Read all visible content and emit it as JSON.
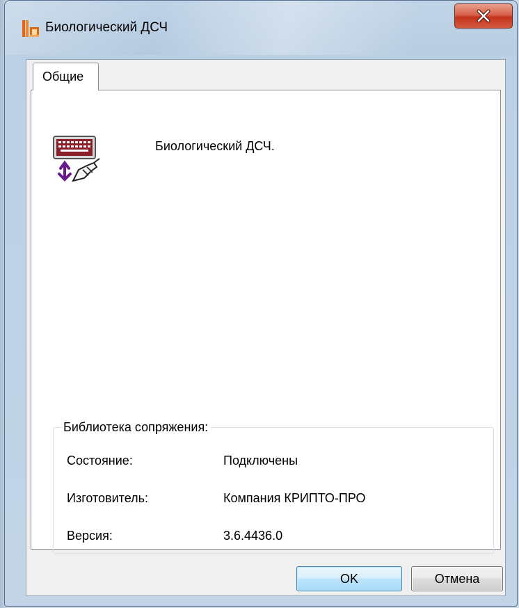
{
  "window": {
    "title": "Биологический ДСЧ",
    "app_icon": "cryptopro-icon",
    "close_icon": "close-x-icon"
  },
  "tabs": [
    {
      "label": "Общие",
      "selected": true
    }
  ],
  "general": {
    "device_icon": "keyboard-mouse-rng-icon",
    "device_name": "Биологический ДСЧ."
  },
  "interface_library": {
    "title": "Библиотека сопряжения:",
    "rows": [
      {
        "label": "Состояние:",
        "value": "Подключены"
      },
      {
        "label": "Изготовитель:",
        "value": "Компания КРИПТО-ПРО"
      },
      {
        "label": "Версия:",
        "value": "3.6.4436.0"
      }
    ]
  },
  "buttons": {
    "ok": "OK",
    "cancel": "Отмена"
  },
  "colors": {
    "close_button": "#c2331c",
    "ok_button_border": "#3c7fb1"
  }
}
